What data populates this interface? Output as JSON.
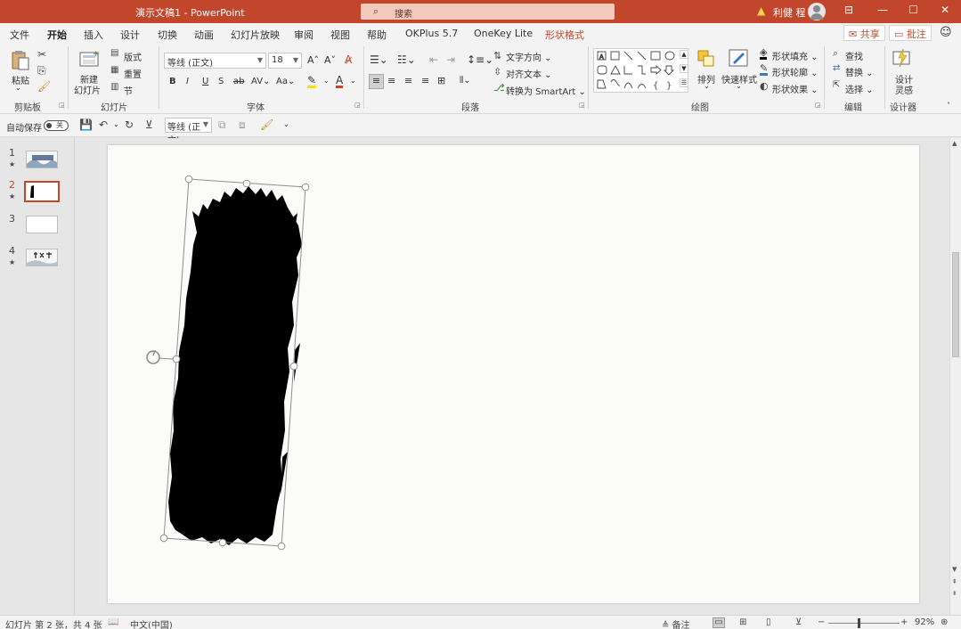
{
  "titlebar": {
    "title": "演示文稿1  -  PowerPoint",
    "search_placeholder": "搜索",
    "username": "利健 程",
    "minimize": "—",
    "maximize": "☐",
    "close": "✕",
    "ribbon_display": "⊟"
  },
  "tabs": [
    "文件",
    "开始",
    "插入",
    "设计",
    "切换",
    "动画",
    "幻灯片放映",
    "审阅",
    "视图",
    "帮助",
    "OKPlus 5.7",
    "OneKey Lite",
    "形状格式"
  ],
  "header_buttons": {
    "share": "共享",
    "comments": "批注"
  },
  "ribbon": {
    "clipboard": {
      "label": "剪贴板",
      "paste": "粘贴"
    },
    "slides": {
      "label": "幻灯片",
      "new_slide_line1": "新建",
      "new_slide_line2": "幻灯片",
      "layout": "版式",
      "reset": "重置",
      "section": "节"
    },
    "font": {
      "label": "字体",
      "font_name": "等线 (正文)",
      "font_size": "18"
    },
    "paragraph": {
      "label": "段落",
      "text_direction": "文字方向",
      "align_text": "对齐文本",
      "smartart": "转换为 SmartArt"
    },
    "drawing": {
      "label": "绘图",
      "arrange": "排列",
      "quick_styles": "快速样式",
      "shape_fill": "形状填充",
      "shape_outline": "形状轮廓",
      "shape_effects": "形状效果"
    },
    "editing": {
      "label": "编辑",
      "find": "查找",
      "replace": "替换",
      "select": "选择"
    },
    "designer": {
      "label": "设计器",
      "ideas_line1": "设计",
      "ideas_line2": "灵感"
    }
  },
  "qat": {
    "autosave": "自动保存",
    "autosave_state": "关",
    "font_name": "等线 (正文)"
  },
  "slides_panel": [
    {
      "number": "1",
      "starred": true
    },
    {
      "number": "2",
      "starred": true
    },
    {
      "number": "3",
      "starred": false
    },
    {
      "number": "4",
      "starred": true
    }
  ],
  "statusbar": {
    "slide_info": "幻灯片 第 2 张，共 4 张",
    "language": "中文(中国)",
    "notes": "备注",
    "zoom": "92%"
  },
  "colors": {
    "accent": "#c2462b",
    "titlebar": "#c2462b",
    "ribbon_bg": "#f3f3f3",
    "slide_bg": "#fbfbfa",
    "brush": "#000000"
  }
}
